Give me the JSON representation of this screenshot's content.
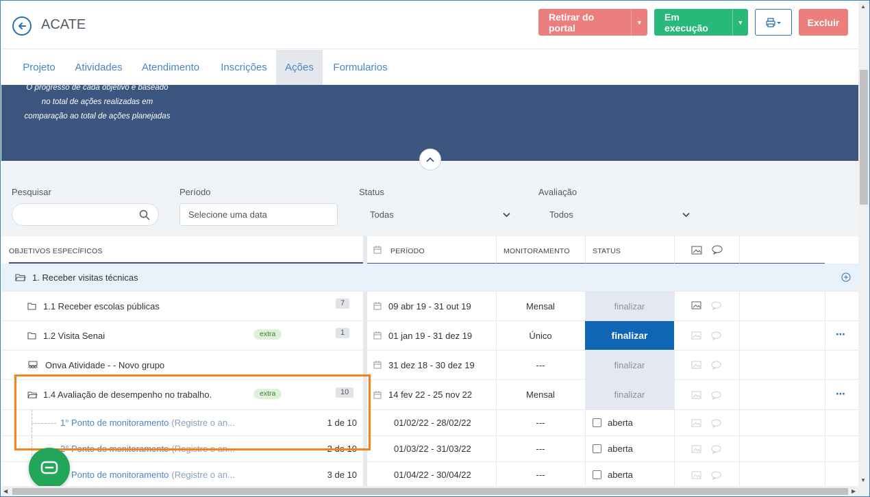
{
  "header": {
    "title": "ACATE",
    "btn_retirar": "Retirar do portal",
    "btn_execucao": "Em execução",
    "btn_excluir": "Excluir",
    "colors": {
      "retirar": "#ec7e7d",
      "execucao": "#28b97a",
      "excluir": "#ec7e7d"
    }
  },
  "tabs": [
    "Projeto",
    "Atividades",
    "Atendimento",
    "Inscrições",
    "Ações",
    "Formularios"
  ],
  "active_tab": "Ações",
  "banner": {
    "line1": "O progresso de cada objetivo é baseado",
    "line2": "no total de ações realizadas em",
    "line3": "comparação ao total de ações planejadas"
  },
  "filters": {
    "search_label": "Pesquisar",
    "periodo_label": "Período",
    "periodo_placeholder": "Selecione uma data",
    "status_label": "Status",
    "status_value": "Todas",
    "avaliacao_label": "Avaliação",
    "avaliacao_value": "Todos"
  },
  "table": {
    "headers": {
      "objetivos": "OBJETIVOS ESPECÍFICOS",
      "periodo": "PERÍODO",
      "monitoramento": "MONITORAMENTO",
      "status": "STATUS"
    },
    "group": "1. Receber visitas técnicas",
    "rows": [
      {
        "name": "1.1 Receber escolas públicas",
        "count": "7",
        "periodo": "09 abr 19 - 31 out 19",
        "monitoramento": "Mensal",
        "status": "finalizar"
      },
      {
        "name": "1.2 Visita Senai",
        "extra": "extra",
        "count": "1",
        "periodo": "01 jan 19 - 31 dez 19",
        "monitoramento": "Único",
        "status": "finalizar"
      },
      {
        "name": "Onva Atividade - - Novo grupo",
        "periodo": "31 dez 18 - 30 dez 19",
        "monitoramento": "---",
        "status": "finalizar"
      },
      {
        "name": "1.4 Avaliação de desempenho no trabalho.",
        "extra": "extra",
        "count": "10",
        "periodo": "14 fev 22 - 25 nov 22",
        "monitoramento": "Mensal",
        "status": "finalizar"
      }
    ],
    "subrows": [
      {
        "name": "1° Ponto de monitoramento",
        "note": "(Registre o an...",
        "count": "1 de 10",
        "periodo": "01/02/22 - 28/02/22",
        "monitoramento": "---",
        "status": "aberta"
      },
      {
        "name": "2° Ponto de monitoramento",
        "note": "(Registre o an...",
        "count": "2 de 10",
        "periodo": "01/03/22 - 31/03/22",
        "monitoramento": "---",
        "status": "aberta"
      },
      {
        "name": "3° Ponto de monitoramento",
        "note": "(Registre o an...",
        "count": "3 de 10",
        "periodo": "01/04/22 - 30/04/22",
        "monitoramento": "---",
        "status": "aberta"
      }
    ]
  }
}
